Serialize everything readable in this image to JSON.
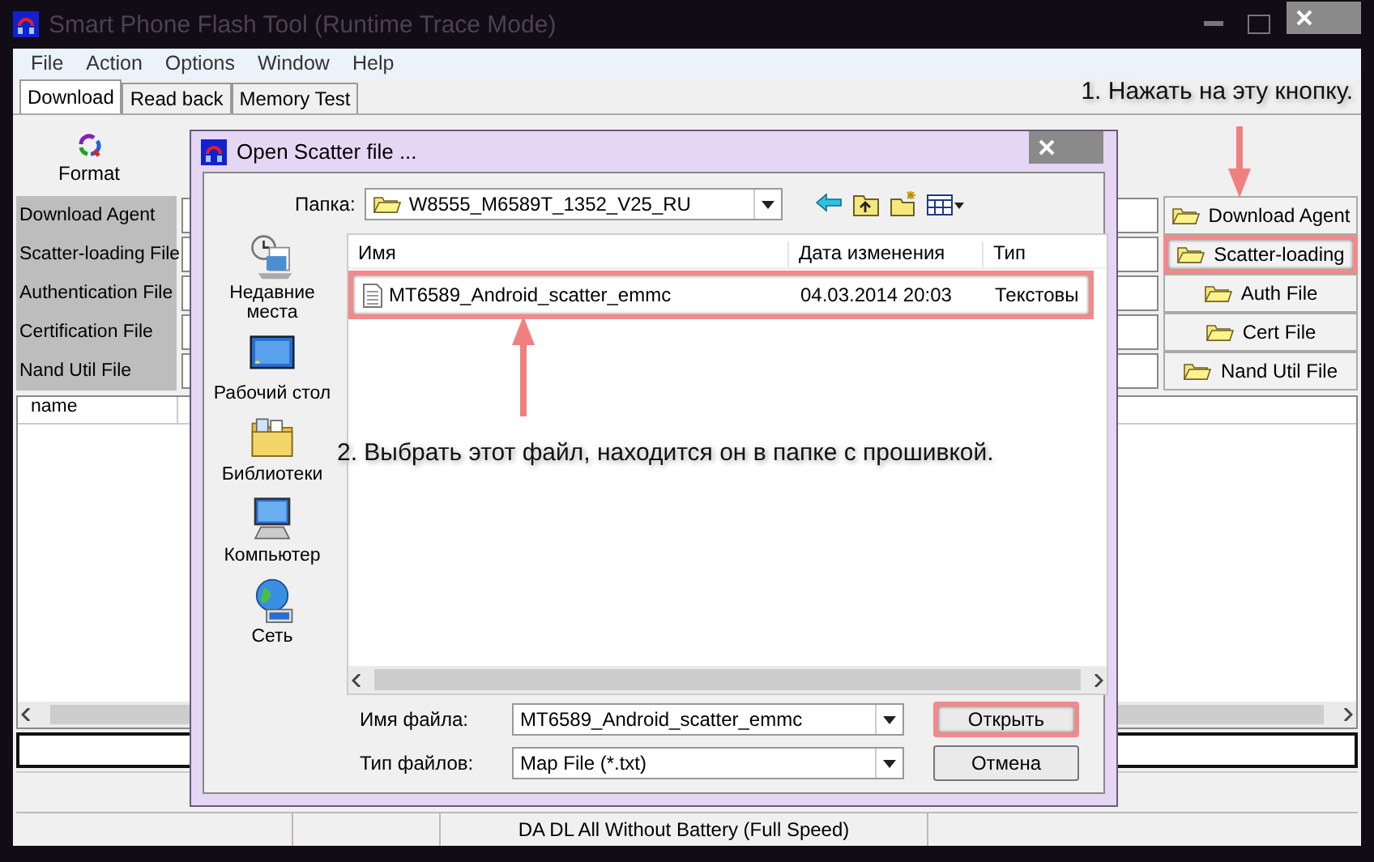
{
  "window": {
    "title": "Smart Phone Flash Tool (Runtime Trace Mode)"
  },
  "menu": [
    "File",
    "Action",
    "Options",
    "Window",
    "Help"
  ],
  "tabs": [
    {
      "label": "Download",
      "selected": true
    },
    {
      "label": "Read back",
      "selected": false
    },
    {
      "label": "Memory Test",
      "selected": false
    }
  ],
  "toolbar": [
    {
      "label": "Format"
    }
  ],
  "file_rows": [
    {
      "label": "Download Agent",
      "button": "Download Agent",
      "highlighted": false
    },
    {
      "label": "Scatter-loading File",
      "button": "Scatter-loading",
      "highlighted": true
    },
    {
      "label": "Authentication File",
      "button": "Auth File",
      "highlighted": false
    },
    {
      "label": "Certification File",
      "button": "Cert File",
      "highlighted": false
    },
    {
      "label": "Nand Util File",
      "button": "Nand Util File",
      "highlighted": false
    }
  ],
  "list": {
    "columns": [
      "name"
    ]
  },
  "progress": {
    "level": 0
  },
  "status_bar": {
    "mode": "DA DL All Without Battery (Full Speed)"
  },
  "dialog": {
    "title": "Open Scatter file ...",
    "folder_label": "Папка:",
    "folder": "W8555_M6589T_1352_V25_RU",
    "places": [
      {
        "label": "Недавние места",
        "kind": "recent"
      },
      {
        "label": "Рабочий стол",
        "kind": "desktop"
      },
      {
        "label": "Библиотеки",
        "kind": "libraries"
      },
      {
        "label": "Компьютер",
        "kind": "computer"
      },
      {
        "label": "Сеть",
        "kind": "network"
      }
    ],
    "columns": [
      "Имя",
      "Дата изменения",
      "Тип"
    ],
    "files": [
      {
        "name": "MT6589_Android_scatter_emmc",
        "modified": "04.03.2014 20:03",
        "type": "Текстовы",
        "highlighted": true
      }
    ],
    "filename_label": "Имя файла:",
    "filename": "MT6589_Android_scatter_emmc",
    "filetype_label": "Тип файлов:",
    "filetype": "Map File (*.txt)",
    "buttons": [
      {
        "label": "Открыть",
        "highlighted": true
      },
      {
        "label": "Отмена",
        "highlighted": false
      }
    ]
  },
  "annotations": [
    {
      "text": "1. Нажать на эту кнопку."
    },
    {
      "text": "2. Выбрать этот файл, находится он в папке с прошивкой."
    }
  ]
}
